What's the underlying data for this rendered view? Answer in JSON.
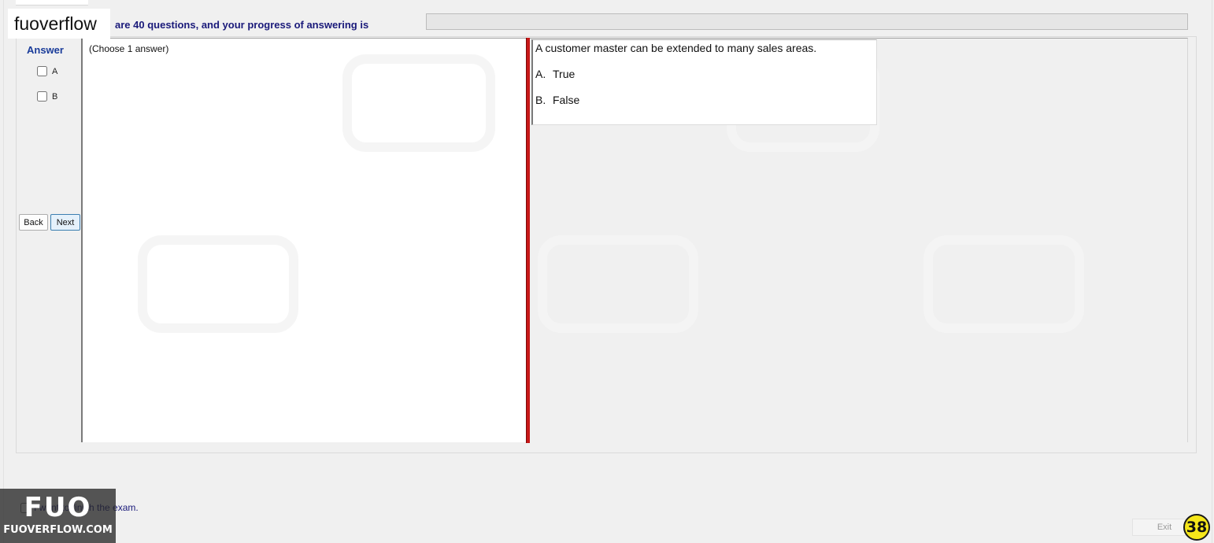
{
  "header": {
    "site_name": "fuoverflow",
    "progress_text": "are 40 questions, and your progress of answering is",
    "progress_percent": 0
  },
  "answer_panel": {
    "heading": "Answer",
    "options": [
      {
        "label": "A",
        "checked": false
      },
      {
        "label": "B",
        "checked": false
      }
    ],
    "back_label": "Back",
    "next_label": "Next"
  },
  "choose_panel": {
    "instruction": "(Choose 1 answer)"
  },
  "question": {
    "text": "A customer master can be extended to many sales areas.",
    "options": [
      {
        "letter": "A.",
        "text": "True"
      },
      {
        "letter": "B.",
        "text": "False"
      }
    ]
  },
  "footer": {
    "finish_text": "I want to finish the exam.",
    "finish_checked": false,
    "exit_label": "Exit",
    "page_number": "38"
  },
  "logo": {
    "big": "FUO",
    "small": "FUOVERFLOW.COM"
  },
  "colors": {
    "divider": "#c81818",
    "heading": "#1a3c9a",
    "progress_text": "#1a1a7a",
    "page_badge": "#f5e61a"
  }
}
